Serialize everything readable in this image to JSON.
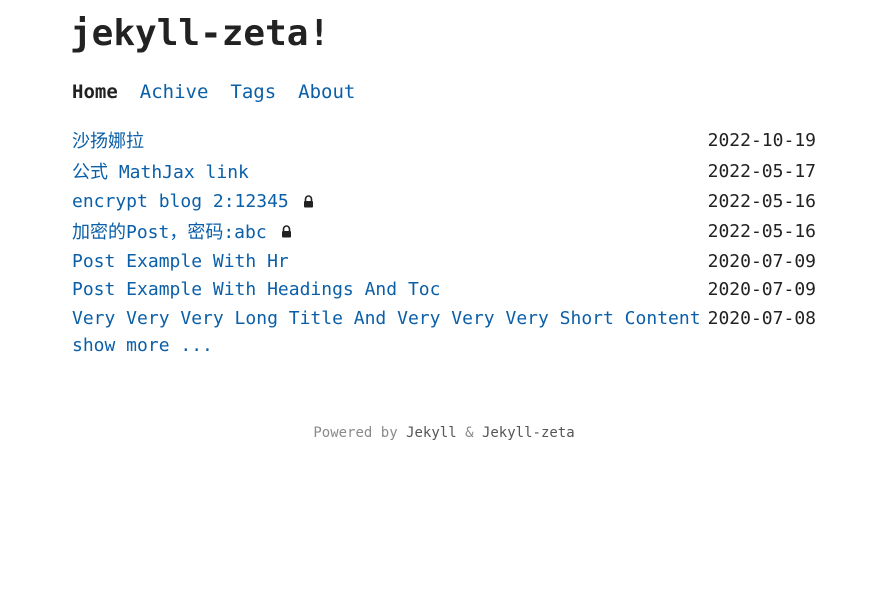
{
  "site": {
    "title": "jekyll-zeta!"
  },
  "nav": {
    "items": [
      {
        "label": "Home",
        "active": true
      },
      {
        "label": "Achive",
        "active": false
      },
      {
        "label": "Tags",
        "active": false
      },
      {
        "label": "About",
        "active": false
      }
    ]
  },
  "posts": [
    {
      "title": "沙扬娜拉",
      "date": "2022-10-19",
      "locked": false
    },
    {
      "title": "公式 MathJax link",
      "date": "2022-05-17",
      "locked": false
    },
    {
      "title": "encrypt blog 2:12345",
      "date": "2022-05-16",
      "locked": true
    },
    {
      "title": "加密的Post，密码:abc",
      "date": "2022-05-16",
      "locked": true
    },
    {
      "title": "Post Example With Hr",
      "date": "2020-07-09",
      "locked": false
    },
    {
      "title": "Post Example With Headings And Toc",
      "date": "2020-07-09",
      "locked": false
    },
    {
      "title": "Very Very Very Long Title And Very Very Very Short Content",
      "date": "2020-07-08",
      "locked": false
    }
  ],
  "show_more": "show more ...",
  "footer": {
    "prefix": "Powered by ",
    "link1": "Jekyll",
    "separator": " & ",
    "link2": "Jekyll-zeta"
  },
  "icons": {
    "lock": "lock-icon"
  },
  "colors": {
    "link": "#0a5fa8",
    "text": "#222222",
    "muted": "#8a8a8a"
  }
}
